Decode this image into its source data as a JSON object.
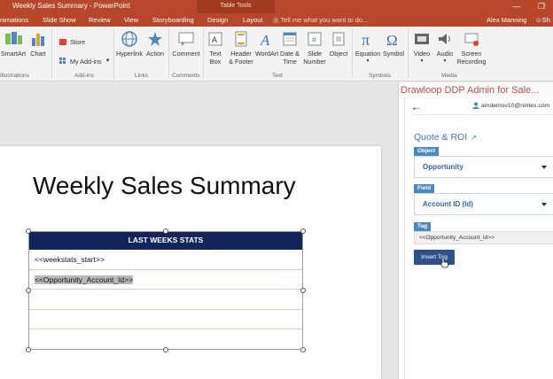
{
  "window": {
    "title": "Weekly Sales Summary - PowerPoint",
    "context_tab": "Table Tools",
    "tabs": [
      "nimations",
      "Slide Show",
      "Review",
      "View",
      "Storyboarding",
      "Design",
      "Layout"
    ],
    "tell_me": "Tell me what you want to do...",
    "user": "Alex Manning",
    "share": "Sh"
  },
  "ribbon": {
    "illustrations": {
      "group": "Illustrations",
      "smartart": "SmartArt",
      "chart": "Chart"
    },
    "addins": {
      "group": "Add-ins",
      "store": "Store",
      "my_addins": "My Add-ins"
    },
    "links": {
      "group": "Links",
      "hyperlink": "Hyperlink",
      "action": "Action"
    },
    "comments": {
      "group": "Comments",
      "comment": "Comment"
    },
    "text": {
      "group": "Text",
      "textbox_1": "Text",
      "textbox_2": "Box",
      "header_1": "Header",
      "header_2": "& Footer",
      "wordart": "WordArt",
      "datetime_1": "Date &",
      "datetime_2": "Time",
      "slidenum_1": "Slide",
      "slidenum_2": "Number",
      "object": "Object"
    },
    "symbols": {
      "group": "Symbols",
      "equation": "Equation",
      "symbol": "Symbol"
    },
    "media": {
      "group": "Media",
      "video": "Video",
      "audio": "Audio",
      "screen_1": "Screen",
      "screen_2": "Recording"
    }
  },
  "slide": {
    "title": "Weekly Sales Summary",
    "table": {
      "header": "LAST WEEKS STATS",
      "rows": [
        "<<weekstats_start>>",
        "<<Opportunity_Account_Id>>",
        "",
        "",
        ""
      ]
    }
  },
  "panel": {
    "title": "Drawloop DDP Admin for Sale...",
    "account": "amdemov10@nintex.com",
    "heading": "Quote & ROI",
    "object_label": "Object",
    "object_value": "Opportunity",
    "field_label": "Field",
    "field_value": "Account ID (Id)",
    "tag_label": "Tag",
    "tag_value": "<<Opportunity_Account_Id>>",
    "insert_button": "Insert Tag"
  },
  "colors": {
    "accent": "#b7472a",
    "table_header": "#13245a",
    "panel_blue": "#3a7cc0",
    "panel_title": "#c0504d"
  }
}
